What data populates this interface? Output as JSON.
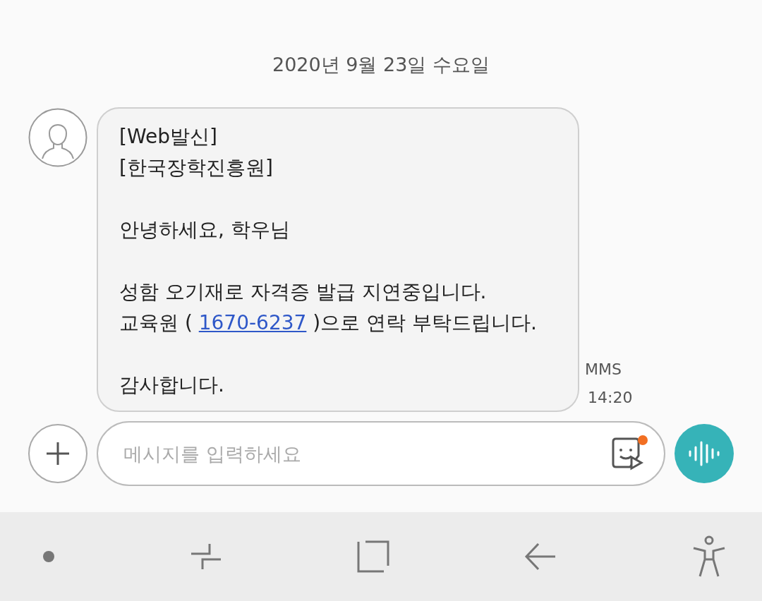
{
  "date_header": "2020년 9월 23일 수요일",
  "message": {
    "paragraphs": [
      [
        [
          {
            "kind": "text",
            "text": "[Web발신]"
          }
        ],
        [
          {
            "kind": "text",
            "text": "[한국장학진흥원]"
          }
        ]
      ],
      [
        [
          {
            "kind": "text",
            "text": "안녕하세요, 학우님"
          }
        ]
      ],
      [
        [
          {
            "kind": "text",
            "text": "성함 오기재로 자격증 발급 지연중입니다."
          }
        ],
        [
          {
            "kind": "text",
            "text": "교육원 ( "
          },
          {
            "kind": "link",
            "text": "1670-6237"
          },
          {
            "kind": "text",
            "text": " )으로 연락 부탁드립니다."
          }
        ]
      ],
      [
        [
          {
            "kind": "text",
            "text": "감사합니다."
          }
        ]
      ]
    ],
    "type": "MMS",
    "time": "14:20"
  },
  "composer": {
    "placeholder": "메시지를 입력하세요",
    "sticker_badge": true
  }
}
